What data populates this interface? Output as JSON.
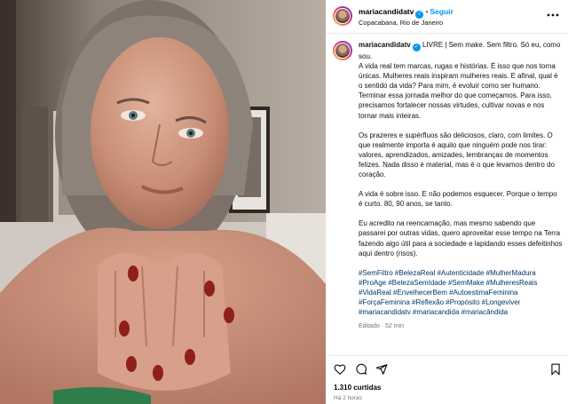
{
  "header": {
    "username": "mariacandidatv",
    "follow_label": "Seguir",
    "location": "Copacabana, Rio de Janeiro"
  },
  "caption": {
    "username": "mariacandidatv",
    "intro": "LIVRE | Sem make. Sem filtro. Só eu, como sou.",
    "paragraph1": "A vida real tem marcas, rugas e histórias. É isso que nos torna únicas. Mulheres reais inspiram mulheres reais. E afinal, qual é o sentido da vida? Para mim, é evoluir como ser humano. Terminar essa jornada melhor do que começamos. Para isso, precisamos fortalecer nossas virtudes, cultivar novas e nos tornar mais inteiras.",
    "paragraph2": "Os prazeres e supérfluos são deliciosos, claro, com limites. O que realmente importa é aquilo que ninguém pode nos tirar: valores, aprendizados, amizades, lembranças de momentos felizes. Nada disso é material, mas é o que levamos dentro do coração.",
    "paragraph3": "A vida é sobre isso. E não podemos esquecer. Porque o tempo é curto. 80, 90 anos, se tanto.",
    "paragraph4": "Eu acredito na reencarnação, mas mesmo sabendo que passarei por outras vidas, quero aproveitar esse tempo na Terra fazendo algo útil para a sociedade e lapidando esses defeitinhos aqui dentro (risos).",
    "hashtags": "#SemFiltro #BelezaReal #Autenticidade #MulherMadura #ProAge #BelezaSemIdade #SemMake #MulheresReais #VidaReal #EnvelhecerBem #AutoestimaFeminina #ForçaFeminina #Reflexão #Propósito #Longeviver #mariacandidatv #mariacandida #mariacândida",
    "edited": "Editado · 52 min"
  },
  "actions": {
    "likes": "1.310 curtidas",
    "time": "Há 2 horas"
  },
  "icons": [
    "verified-icon",
    "more-icon",
    "heart-icon",
    "comment-icon",
    "share-icon",
    "bookmark-icon"
  ],
  "colors": {
    "link": "#0095f6",
    "hashtag": "#00376b",
    "muted": "#737373"
  }
}
